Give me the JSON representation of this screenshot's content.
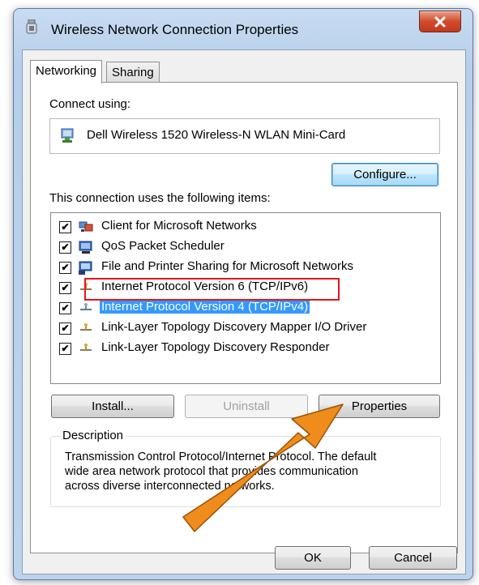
{
  "window": {
    "title": "Wireless Network Connection Properties",
    "close_label": "✕"
  },
  "tabs": [
    {
      "label": "Networking",
      "active": true
    },
    {
      "label": "Sharing",
      "active": false
    }
  ],
  "connect": {
    "label": "Connect using:",
    "adapter": "Dell Wireless 1520 Wireless-N WLAN Mini-Card",
    "configure_label": "Configure..."
  },
  "items": {
    "label": "This connection uses the following items:",
    "list": [
      {
        "label": "Client for Microsoft Networks",
        "checked": true,
        "icon": "client-network-icon",
        "selected": false
      },
      {
        "label": "QoS Packet Scheduler",
        "checked": true,
        "icon": "scheduler-icon",
        "selected": false
      },
      {
        "label": "File and Printer Sharing for Microsoft Networks",
        "checked": true,
        "icon": "file-printer-sharing-icon",
        "selected": false
      },
      {
        "label": "Internet Protocol Version 6 (TCP/IPv6)",
        "checked": true,
        "icon": "protocol-icon",
        "selected": false,
        "highlighted": true
      },
      {
        "label": "Internet Protocol Version 4 (TCP/IPv4)",
        "checked": true,
        "icon": "protocol-icon",
        "selected": true
      },
      {
        "label": "Link-Layer Topology Discovery Mapper I/O Driver",
        "checked": true,
        "icon": "protocol-icon",
        "selected": false
      },
      {
        "label": "Link-Layer Topology Discovery Responder",
        "checked": true,
        "icon": "protocol-icon",
        "selected": false
      }
    ],
    "install_label": "Install...",
    "uninstall_label": "Uninstall",
    "properties_label": "Properties"
  },
  "description": {
    "title": "Description",
    "lines": [
      "Transmission Control Protocol/Internet Protocol. The default",
      "wide area network protocol that provides communication",
      "across diverse interconnected networks."
    ]
  },
  "footer": {
    "ok_label": "OK",
    "cancel_label": "Cancel"
  },
  "colors": {
    "highlight_box": "#e8141c",
    "selection": "#3399ff",
    "annotation_arrow": "#f08c1c"
  }
}
